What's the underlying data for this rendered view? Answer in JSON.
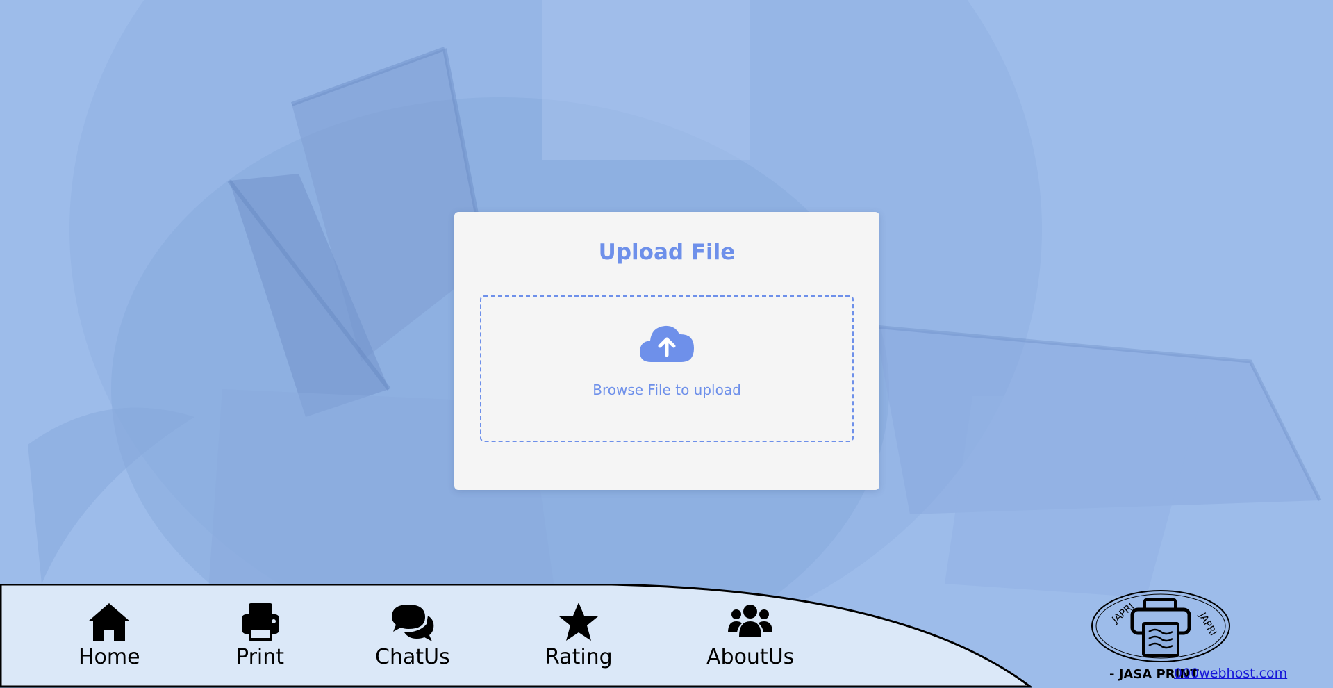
{
  "upload": {
    "title": "Upload File",
    "browse_text": "Browse File to upload"
  },
  "nav": {
    "items": [
      {
        "label": "Home",
        "icon": "home-icon"
      },
      {
        "label": "Print",
        "icon": "printer-icon"
      },
      {
        "label": "ChatUs",
        "icon": "chat-icon"
      },
      {
        "label": "Rating",
        "icon": "star-icon"
      },
      {
        "label": "AboutUs",
        "icon": "users-icon"
      }
    ]
  },
  "logo": {
    "text_left": "JAPRI",
    "text_right": "JAPRI"
  },
  "footer": {
    "brand": "- JASA PRINT",
    "link": "000webhost.com"
  },
  "colors": {
    "background": "#9dbcea",
    "accent": "#6e90ea",
    "card": "#f5f5f5",
    "nav_bg": "#dbe8f8",
    "link": "#1515d8"
  }
}
